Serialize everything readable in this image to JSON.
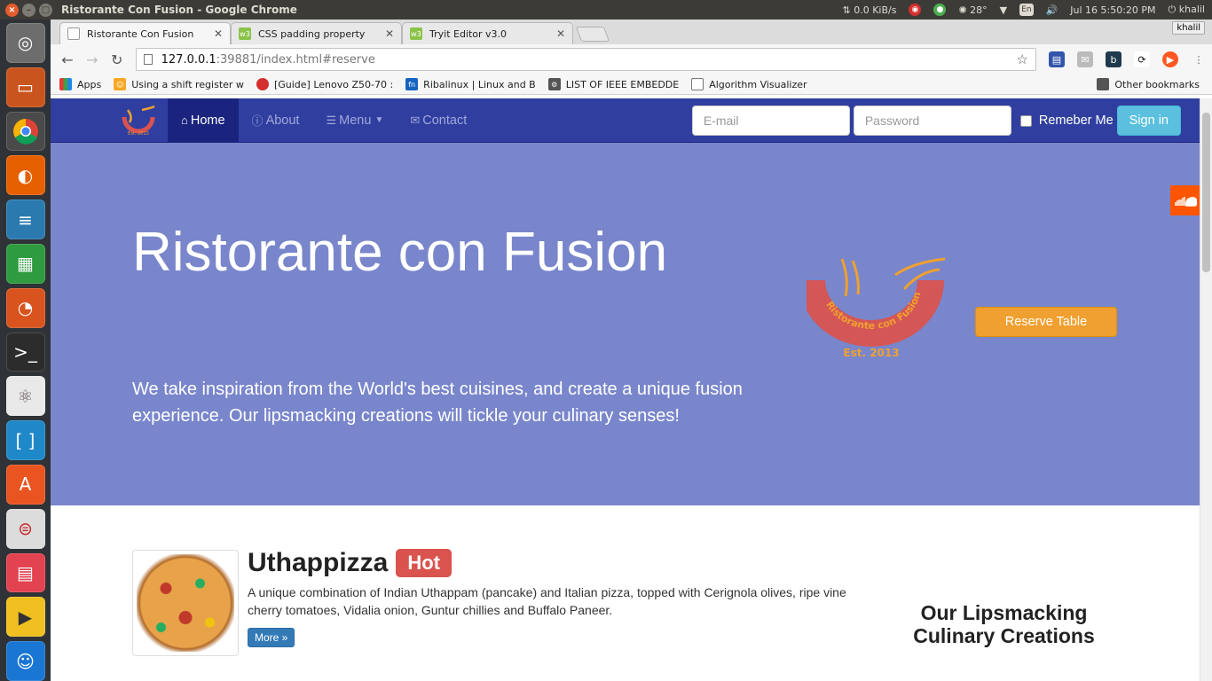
{
  "os": {
    "window_title": "Ristorante Con Fusion - Google Chrome",
    "net_speed": "0.0 KiB/s",
    "temperature": "28°",
    "keyboard_layout": "En",
    "clock": "Jul 16  5:50:20 PM",
    "user": "khalil"
  },
  "browser": {
    "tabs": [
      {
        "label": "Ristorante Con Fusion",
        "active": true
      },
      {
        "label": "CSS padding property",
        "active": false
      },
      {
        "label": "Tryit Editor v3.0",
        "active": false
      }
    ],
    "profile": "khalil",
    "url_host": "127.0.0.1",
    "url_rest": ":39881/index.html#reserve",
    "bookmarks": [
      {
        "label": "Apps"
      },
      {
        "label": "Using a shift register w"
      },
      {
        "label": "[Guide] Lenovo Z50-70 :"
      },
      {
        "label": "Ribalinux | Linux and B"
      },
      {
        "label": "LIST OF IEEE EMBEDDE"
      },
      {
        "label": "Algorithm Visualizer"
      }
    ],
    "other_bookmarks": "Other bookmarks"
  },
  "navbar": {
    "items": [
      {
        "label": "Home",
        "icon": "home-icon",
        "active": true
      },
      {
        "label": "About",
        "icon": "info-icon",
        "active": false
      },
      {
        "label": "Menu",
        "icon": "list-icon",
        "active": false,
        "caret": true
      },
      {
        "label": "Contact",
        "icon": "envelope-icon",
        "active": false
      }
    ],
    "email_placeholder": "E-mail",
    "password_placeholder": "Password",
    "remember_label": "Remeber Me",
    "signin_label": "Sign in"
  },
  "jumbotron": {
    "title": "Ristorante con Fusion",
    "text": "We take inspiration from the World's best cuisines, and create a unique fusion experience. Our lipsmacking creations will tickle your culinary senses!",
    "reserve_label": "Reserve Table",
    "logo_text": "Ristorante con Fusion",
    "logo_est": "Est. 2013"
  },
  "dish": {
    "name": "Uthappizza",
    "badge": "Hot",
    "description": "A unique combination of Indian Uthappam (pancake) and Italian pizza, topped with Cerignola olives, ripe vine cherry tomatoes, Vidalia onion, Guntur chillies and Buffalo Paneer.",
    "more_label": "More »"
  },
  "side_heading": "Our Lipsmacking Culinary Creations",
  "colors": {
    "navbar": "#303f9f",
    "navbar_active": "#1a237e",
    "jumbotron": "#7986cb",
    "reserve": "#f0a030",
    "signin": "#5bc0de",
    "hot": "#d9534f"
  }
}
